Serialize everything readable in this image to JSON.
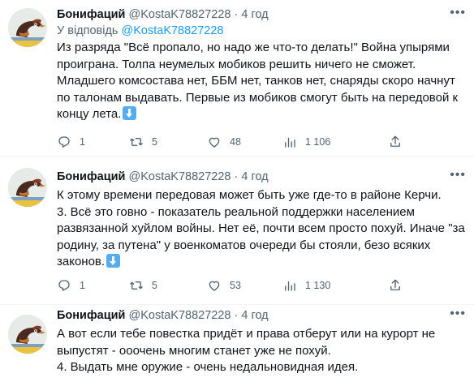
{
  "tweets": [
    {
      "name": "Бонифаций",
      "handle": "@KostaK78827228",
      "dot": "·",
      "time": "4 год",
      "reply_prefix": "У відповідь",
      "reply_mention": "@KostaK78827228",
      "text": "Из разряда \"Всё пропало, но надо же что-то делать!\" Война упырями проиграна. Толпа неумелых мобиков решить ничего не сможет. Младшего комсостава нет, ББМ нет, танков нет, снаряды скоро начнут по талонам выдавать. Первые из мобиков смогут быть на передовой к концу лета.",
      "replies": "1",
      "retweets": "5",
      "likes": "48",
      "views": "1 106"
    },
    {
      "name": "Бонифаций",
      "handle": "@KostaK78827228",
      "dot": "·",
      "time": "4 год",
      "text": "К этому времени передовая может быть уже где-то в районе Керчи.\n3. Всё это говно - показатель реальной поддержки населением развязанной хуйлом войны. Нет её, почти всем просто похуй. Иначе \"за родину, за путена\" у военкоматов очереди бы стояли, безо всяких законов.",
      "replies": "1",
      "retweets": "5",
      "likes": "53",
      "views": "1 130"
    },
    {
      "name": "Бонифаций",
      "handle": "@KostaK78827228",
      "dot": "·",
      "time": "4 год",
      "text": "А вот если тебе повестка придёт и права отберут или на курорт не выпустят - ооочень многим станет уже не похуй.\n4. Выдать мне оружие - очень недальновидная идея."
    }
  ],
  "icons": [
    "more-icon",
    "reply-icon",
    "retweet-icon",
    "like-icon",
    "views-icon",
    "share-icon",
    "down-arrow-emoji"
  ],
  "colors": {
    "link": "#1d9bf0",
    "muted": "#536471",
    "thread_line": "#cfd9de",
    "emoji_bg": "#55acee"
  }
}
